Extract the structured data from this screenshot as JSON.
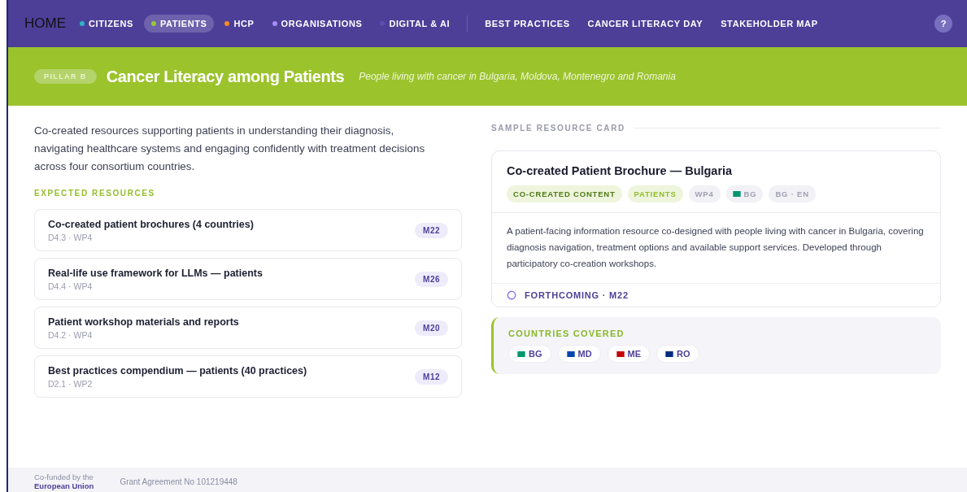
{
  "nav": {
    "home": "HOME",
    "items": [
      {
        "label": "CITIZENS",
        "kind": "audience",
        "color": "#2bb5c4",
        "selected": false
      },
      {
        "label": "PATIENTS",
        "kind": "audience",
        "color": "#9bc832",
        "selected": true
      },
      {
        "label": "HCP",
        "kind": "audience",
        "color": "#f28c28",
        "selected": false
      },
      {
        "label": "ORGANISATIONS",
        "kind": "audience",
        "color": "#a78bfa",
        "selected": false
      },
      {
        "label": "DIGITAL & AI",
        "kind": "audience",
        "color": "#5b4fb0",
        "selected": false
      },
      {
        "label": "BEST PRACTICES",
        "kind": "page",
        "selected": false
      },
      {
        "label": "CANCER LITERACY DAY",
        "kind": "page",
        "selected": false
      },
      {
        "label": "STAKEHOLDER MAP",
        "kind": "page",
        "selected": false
      }
    ],
    "help": "?"
  },
  "banner": {
    "pillar": "PILLAR B",
    "title": "Cancer Literacy among Patients",
    "subtitle": "People living with cancer in Bulgaria, Moldova, Montenegro and Romania"
  },
  "intro": "Co-created resources supporting patients in understanding their diagnosis, navigating healthcare systems and engaging confidently with treatment decisions across four consortium countries.",
  "resources": {
    "heading": "EXPECTED RESOURCES",
    "items": [
      {
        "title": "Co-created patient brochures (4 countries)",
        "meta": "D4.3 · WP4",
        "milestone": "M22"
      },
      {
        "title": "Real-life use framework for LLMs — patients",
        "meta": "D4.4 · WP4",
        "milestone": "M26"
      },
      {
        "title": "Patient workshop materials and reports",
        "meta": "D4.2 · WP4",
        "milestone": "M20"
      },
      {
        "title": "Best practices compendium — patients (40 practices)",
        "meta": "D2.1 · WP2",
        "milestone": "M12"
      }
    ]
  },
  "sample": {
    "heading": "SAMPLE RESOURCE CARD",
    "title": "Co-created Patient Brochure — Bulgaria",
    "tags": [
      {
        "label": "CO-CREATED CONTENT",
        "kind": "type"
      },
      {
        "label": "PATIENTS",
        "kind": "audience"
      },
      {
        "label": "WP4",
        "kind": "neutral"
      },
      {
        "label": "BG",
        "kind": "country",
        "color": "#00966e"
      },
      {
        "label": "BG · EN",
        "kind": "neutral"
      }
    ],
    "description": "A patient-facing information resource co-designed with people living with cancer in Bulgaria, covering diagnosis navigation, treatment options and available support services. Developed through participatory co-creation workshops.",
    "status": "FORTHCOMING · M22"
  },
  "countries": {
    "heading": "COUNTRIES COVERED",
    "items": [
      {
        "code": "BG",
        "color": "#00966e"
      },
      {
        "code": "MD",
        "color": "#0046ae"
      },
      {
        "code": "ME",
        "color": "#c40308"
      },
      {
        "code": "RO",
        "color": "#002b7f"
      }
    ]
  },
  "footer": {
    "funded_line1": "Co-funded by the",
    "funded_line2": "European Union",
    "grant": "Grant Agreement No 101219448"
  }
}
